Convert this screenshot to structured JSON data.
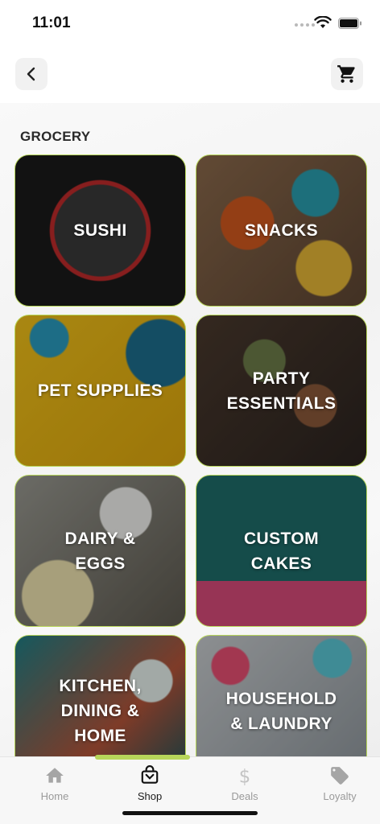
{
  "status_bar": {
    "time": "11:01"
  },
  "header": {
    "back_icon": "chevron-left-icon",
    "cart_icon": "shopping-cart-icon"
  },
  "section": {
    "title": "GROCERY"
  },
  "categories": [
    {
      "label": "SUSHI"
    },
    {
      "label": "SNACKS"
    },
    {
      "label": "PET SUPPLIES"
    },
    {
      "label": "PARTY\nESSENTIALS"
    },
    {
      "label": "DAIRY &\nEGGS"
    },
    {
      "label": "CUSTOM\nCAKES"
    },
    {
      "label": "KITCHEN,\nDINING &\nHOME"
    },
    {
      "label": "HOUSEHOLD\n& LAUNDRY"
    }
  ],
  "tabs": [
    {
      "label": "Home",
      "icon": "home-icon"
    },
    {
      "label": "Shop",
      "icon": "shopping-bag-icon",
      "active": true
    },
    {
      "label": "Deals",
      "icon": "dollar-icon"
    },
    {
      "label": "Loyalty",
      "icon": "tag-icon"
    }
  ],
  "colors": {
    "accent": "#b7d65a",
    "tab_inactive": "#9a9a9a",
    "tab_active": "#1c1c1c"
  }
}
